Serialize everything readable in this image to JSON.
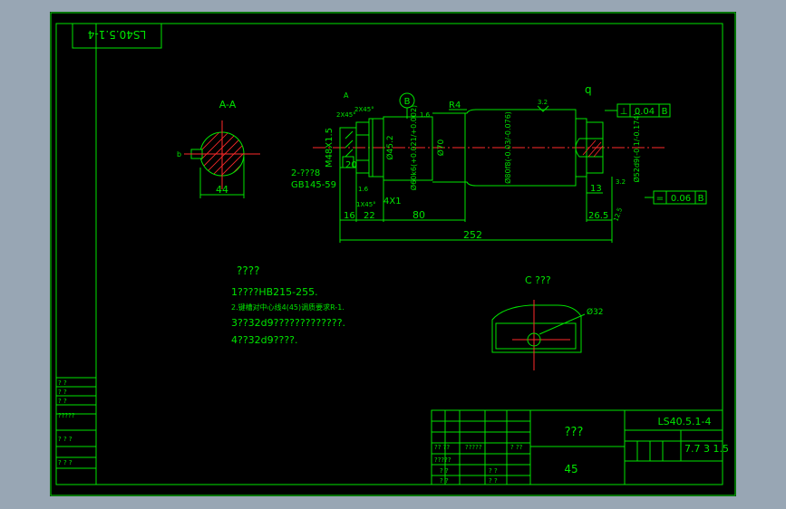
{
  "drawing": {
    "code_rotated": "LS40.5.1-4",
    "section_aa_label": "A-A",
    "section_aa_width": "44",
    "datum_b": "B",
    "view_c_label": "C ???",
    "view_c_dia": "Ø32"
  },
  "shaft": {
    "thread": "M48X1.5",
    "bearing_dia": "Ø60k6(+0.021/+0.002)",
    "dia_70": "Ø70",
    "dia_main": "Ø80f8(-0.03/-0.076)",
    "dia_52": "Ø52d9(-0.1/-0.174)",
    "dia_45_2": "Ø45.2",
    "chamfer": "4X1",
    "radius": "R4",
    "groove_label": "2-???8",
    "std_ref": "GB145-59",
    "roughness_top": "3.2",
    "roughness_a": "1.6",
    "roughness_b": "1.6",
    "roughness_c": "3.2",
    "roughness_d": "12.5",
    "dim_20": "20",
    "dim_16": "16",
    "dim_22": "22",
    "dim_80": "80",
    "dim_252": "252",
    "dim_13": "13",
    "dim_26_5": "26.5",
    "dim_2x45a": "2X45°",
    "dim_2x45b": "2X45°",
    "dim_1x45": "1X45°",
    "label_a": "A",
    "label_q": "q"
  },
  "tolerances": {
    "perp_symbol": "⊥",
    "perp_value": "0.04",
    "perp_datum": "B",
    "sym_symbol": "=",
    "sym_value": "0.06",
    "sym_datum": "B"
  },
  "notes": {
    "heading": "????",
    "lines": [
      "1????HB215-255.",
      "2.键槽对中心线4(45)调质要求R-1.",
      "3??32d9?????????????.",
      "4??32d9????."
    ]
  },
  "title_block": {
    "name": "???",
    "material": "45",
    "code": "LS40.5.1-4",
    "scale_text": "7.7 3 1.5",
    "sub_labels": [
      "?? ??",
      "?????",
      "? ??",
      "?????",
      "? ?",
      "? ?",
      "? ?",
      "? ?"
    ]
  },
  "left_table": {
    "rows": [
      "? ?",
      "? ?",
      "? ?",
      "?????",
      "? ? ?",
      "? ? ?"
    ]
  }
}
